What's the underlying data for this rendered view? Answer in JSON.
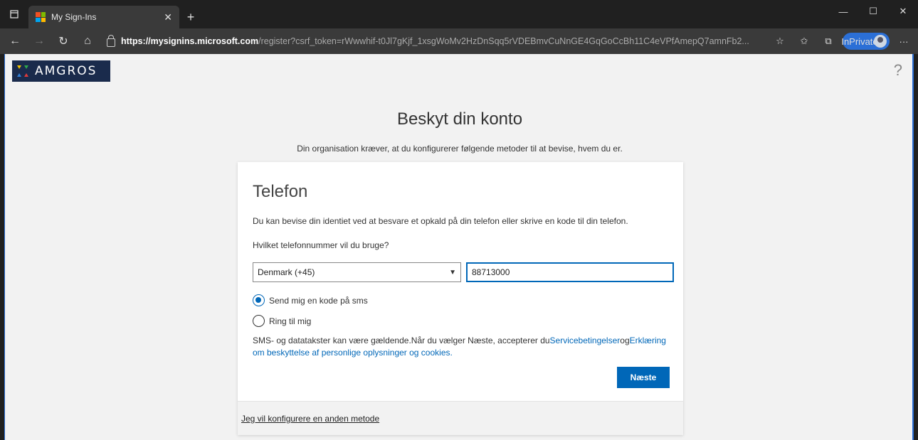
{
  "browser": {
    "tab_title": "My Sign-Ins",
    "url_scheme": "https://",
    "url_host": "mysignins.microsoft.com",
    "url_path": "/register?csrf_token=rWwwhif-t0Jl7gKjf_1xsgWoMv2HzDnSqq5rVDEBmvCuNnGE4GqGoCcBh11C4eVPfAmepQ7amnFb2...",
    "inprivate_label": "InPrivate"
  },
  "header": {
    "logo_text": "AMGROS",
    "help_symbol": "?"
  },
  "page": {
    "title": "Beskyt din konto",
    "subtitle": "Din organisation kræver, at du konfigurerer følgende metoder til at bevise, hvem du er."
  },
  "card": {
    "title": "Telefon",
    "description": "Du kan bevise din identiet ved at besvare et opkald på din telefon eller skrive en kode til din telefon.",
    "question": "Hvilket telefonnummer vil du bruge?",
    "country_selected": "Denmark (+45)",
    "phone_value": "88713000",
    "radio_sms": "Send mig en kode på sms",
    "radio_call": "Ring til mig",
    "legal_text": "SMS- og datatakster kan være gældende.Når du vælger Næste, accepterer du",
    "legal_link1": "Servicebetingelser",
    "legal_og": "og",
    "legal_link2": "Erklæring om beskyttelse af personlige oplysninger og cookies.",
    "next_label": "Næste",
    "other_method": "Jeg vil konfigurere en anden metode"
  },
  "colors": {
    "accent": "#0067b8",
    "logo_bg": "#1a2b4c",
    "inprivate": "#2b6fd6"
  }
}
